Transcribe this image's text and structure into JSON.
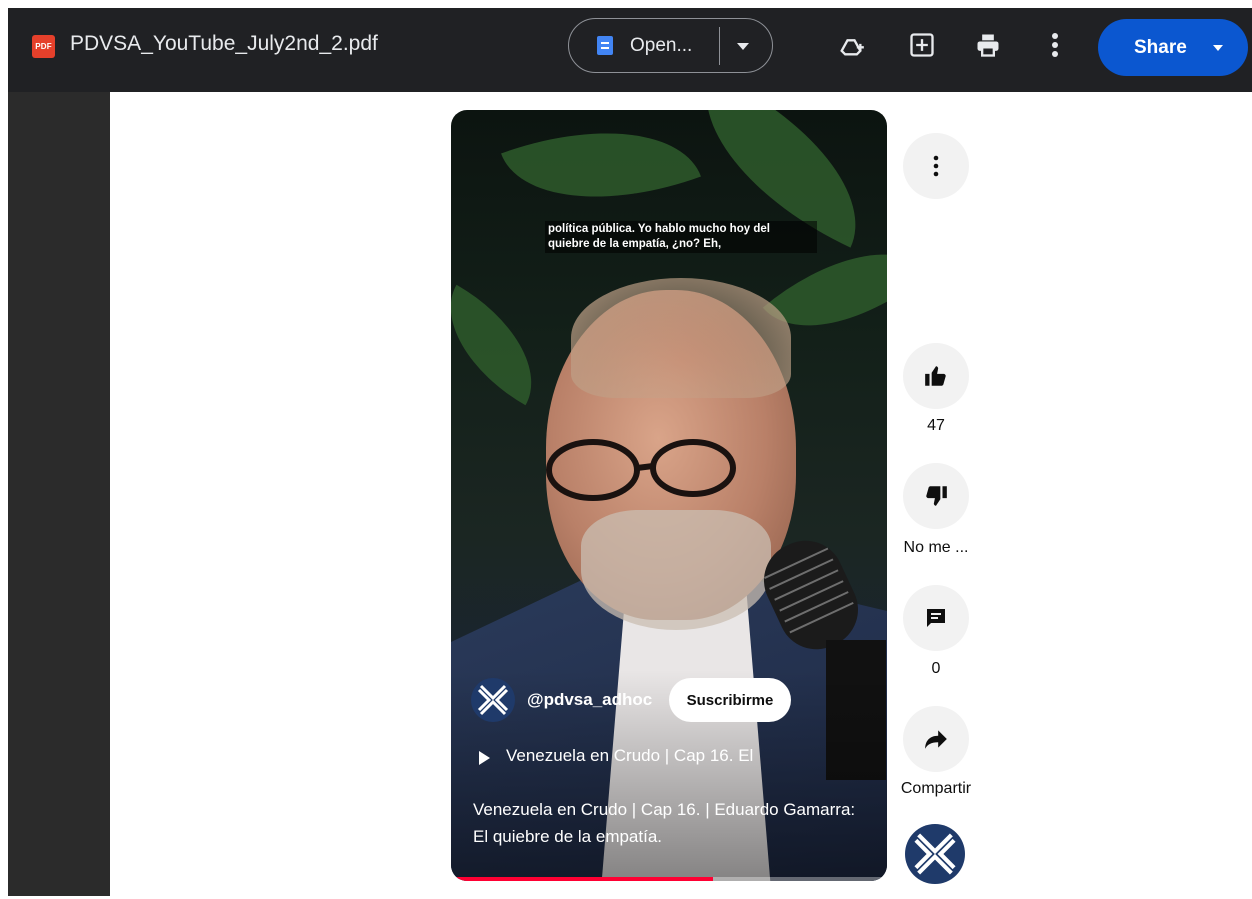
{
  "toolbar": {
    "pdf_badge": "PDF",
    "filename": "PDVSA_YouTube_July2nd_2.pdf",
    "open_label": "Open...",
    "share_label": "Share",
    "icons": [
      "drive-add-icon",
      "add-comment-icon",
      "print-icon",
      "more-vert-icon"
    ]
  },
  "video": {
    "caption": "política pública. Yo hablo mucho hoy del quiebre de la empatía, ¿no? Eh,",
    "channel": "@pdvsa_adhoc",
    "subscribe_label": "Suscribirme",
    "playlist_title": "Venezuela en Crudo | Cap 16. El",
    "description": "Venezuela en Crudo | Cap 16. | Eduardo Gamarra: El quiebre de la empatía.",
    "progress_fraction": 0.6,
    "colors": {
      "progress": "#ff0033",
      "track": "rgba(255,255,255,0.35)"
    }
  },
  "actions": {
    "like_count": "47",
    "dislike_label": "No me ...",
    "comment_count": "0",
    "share_label": "Compartir"
  },
  "colors": {
    "toolbar_bg": "#202124",
    "share_button": "#0b57d0",
    "pdf_badge": "#e5402b"
  }
}
